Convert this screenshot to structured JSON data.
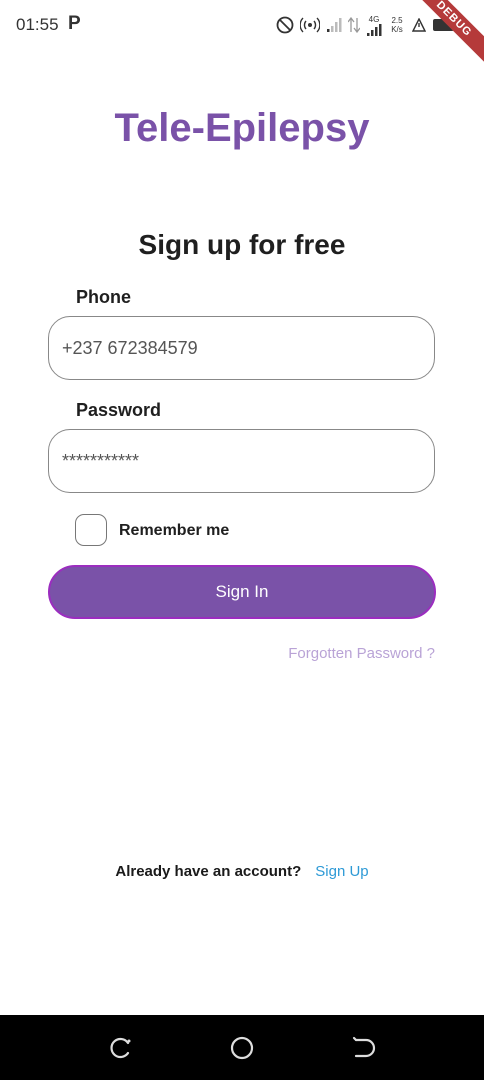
{
  "status_bar": {
    "time": "01:55",
    "network": "4G",
    "speed_value": "2.5",
    "speed_unit": "K/s"
  },
  "debug_banner": "DEBUG",
  "app": {
    "title": "Tele-Epilepsy",
    "accent_color": "#7a52a8"
  },
  "form": {
    "heading": "Sign up for free",
    "phone_label": "Phone",
    "phone_value": "+237 672384579",
    "password_label": "Password",
    "password_value": "***********",
    "remember_label": "Remember me",
    "remember_checked": false,
    "submit_label": "Sign In",
    "forgot_label": "Forgotten Password ?"
  },
  "footer": {
    "account_text": "Already have an account?",
    "signup_label": "Sign Up",
    "link_color": "#2e9ad6"
  },
  "nav_bar": {
    "icons": [
      "recent-apps-icon",
      "home-icon",
      "back-icon"
    ]
  }
}
